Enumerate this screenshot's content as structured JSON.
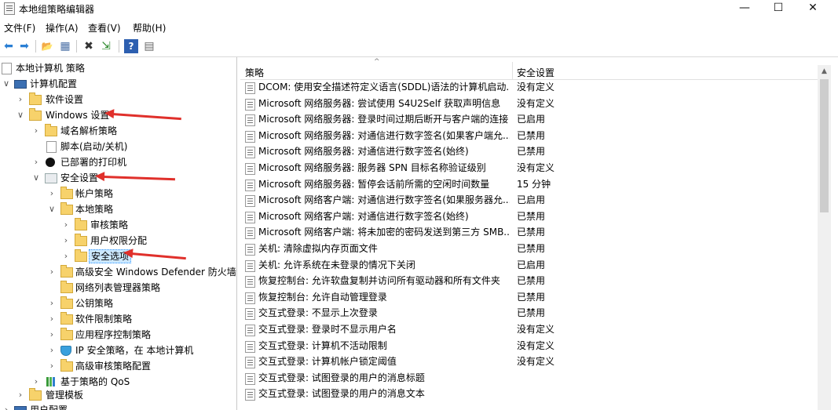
{
  "window": {
    "title": "本地组策略编辑器",
    "minimize": "—",
    "maximize": "☐",
    "close": "✕"
  },
  "menu": [
    "文件(F)",
    "操作(A)",
    "查看(V)",
    "帮助(H)"
  ],
  "toolbar": {
    "back": "⬅",
    "forward": "➡",
    "up": "📂",
    "show_tree": "▦",
    "delete": "✖",
    "export": "⇲",
    "help": "?",
    "properties": "▤"
  },
  "tree": {
    "root": "本地计算机 策略",
    "computer_config": "计算机配置",
    "software_settings": "软件设置",
    "windows_settings": "Windows 设置",
    "dns_policy": "域名解析策略",
    "scripts": "脚本(启动/关机)",
    "printers": "已部署的打印机",
    "security_settings": "安全设置",
    "account_policies": "帐户策略",
    "local_policies": "本地策略",
    "audit_policy": "审核策略",
    "user_rights": "用户权限分配",
    "security_options": "安全选项",
    "defender_firewall": "高级安全 Windows Defender 防火墙",
    "network_list": "网络列表管理器策略",
    "public_key": "公钥策略",
    "software_restriction": "软件限制策略",
    "applocker": "应用程序控制策略",
    "ipsec": "IP 安全策略，在 本地计算机",
    "advanced_audit": "高级审核策略配置",
    "qos": "基于策略的 QoS",
    "admin_templates": "管理模板",
    "user_config": "用户配置"
  },
  "list": {
    "col_policy": "策略",
    "col_setting": "安全设置",
    "rows": [
      {
        "name": "DCOM: 使用安全描述符定义语言(SDDL)语法的计算机启动...",
        "value": "没有定义"
      },
      {
        "name": "Microsoft 网络服务器: 尝试使用 S4U2Self 获取声明信息",
        "value": "没有定义"
      },
      {
        "name": "Microsoft 网络服务器: 登录时间过期后断开与客户端的连接",
        "value": "已启用"
      },
      {
        "name": "Microsoft 网络服务器: 对通信进行数字签名(如果客户端允...",
        "value": "已禁用"
      },
      {
        "name": "Microsoft 网络服务器: 对通信进行数字签名(始终)",
        "value": "已禁用"
      },
      {
        "name": "Microsoft 网络服务器: 服务器 SPN 目标名称验证级别",
        "value": "没有定义"
      },
      {
        "name": "Microsoft 网络服务器: 暂停会话前所需的空闲时间数量",
        "value": "15 分钟"
      },
      {
        "name": "Microsoft 网络客户端: 对通信进行数字签名(如果服务器允...",
        "value": "已启用"
      },
      {
        "name": "Microsoft 网络客户端: 对通信进行数字签名(始终)",
        "value": "已禁用"
      },
      {
        "name": "Microsoft 网络客户端: 将未加密的密码发送到第三方 SMB...",
        "value": "已禁用"
      },
      {
        "name": "关机: 清除虚拟内存页面文件",
        "value": "已禁用"
      },
      {
        "name": "关机: 允许系统在未登录的情况下关闭",
        "value": "已启用"
      },
      {
        "name": "恢复控制台: 允许软盘复制并访问所有驱动器和所有文件夹",
        "value": "已禁用"
      },
      {
        "name": "恢复控制台: 允许自动管理登录",
        "value": "已禁用"
      },
      {
        "name": "交互式登录: 不显示上次登录",
        "value": "已禁用"
      },
      {
        "name": "交互式登录: 登录时不显示用户名",
        "value": "没有定义"
      },
      {
        "name": "交互式登录: 计算机不活动限制",
        "value": "没有定义"
      },
      {
        "name": "交互式登录: 计算机帐户锁定阈值",
        "value": "没有定义"
      },
      {
        "name": "交互式登录: 试图登录的用户的消息标题",
        "value": ""
      },
      {
        "name": "交互式登录: 试图登录的用户的消息文本",
        "value": ""
      }
    ]
  }
}
